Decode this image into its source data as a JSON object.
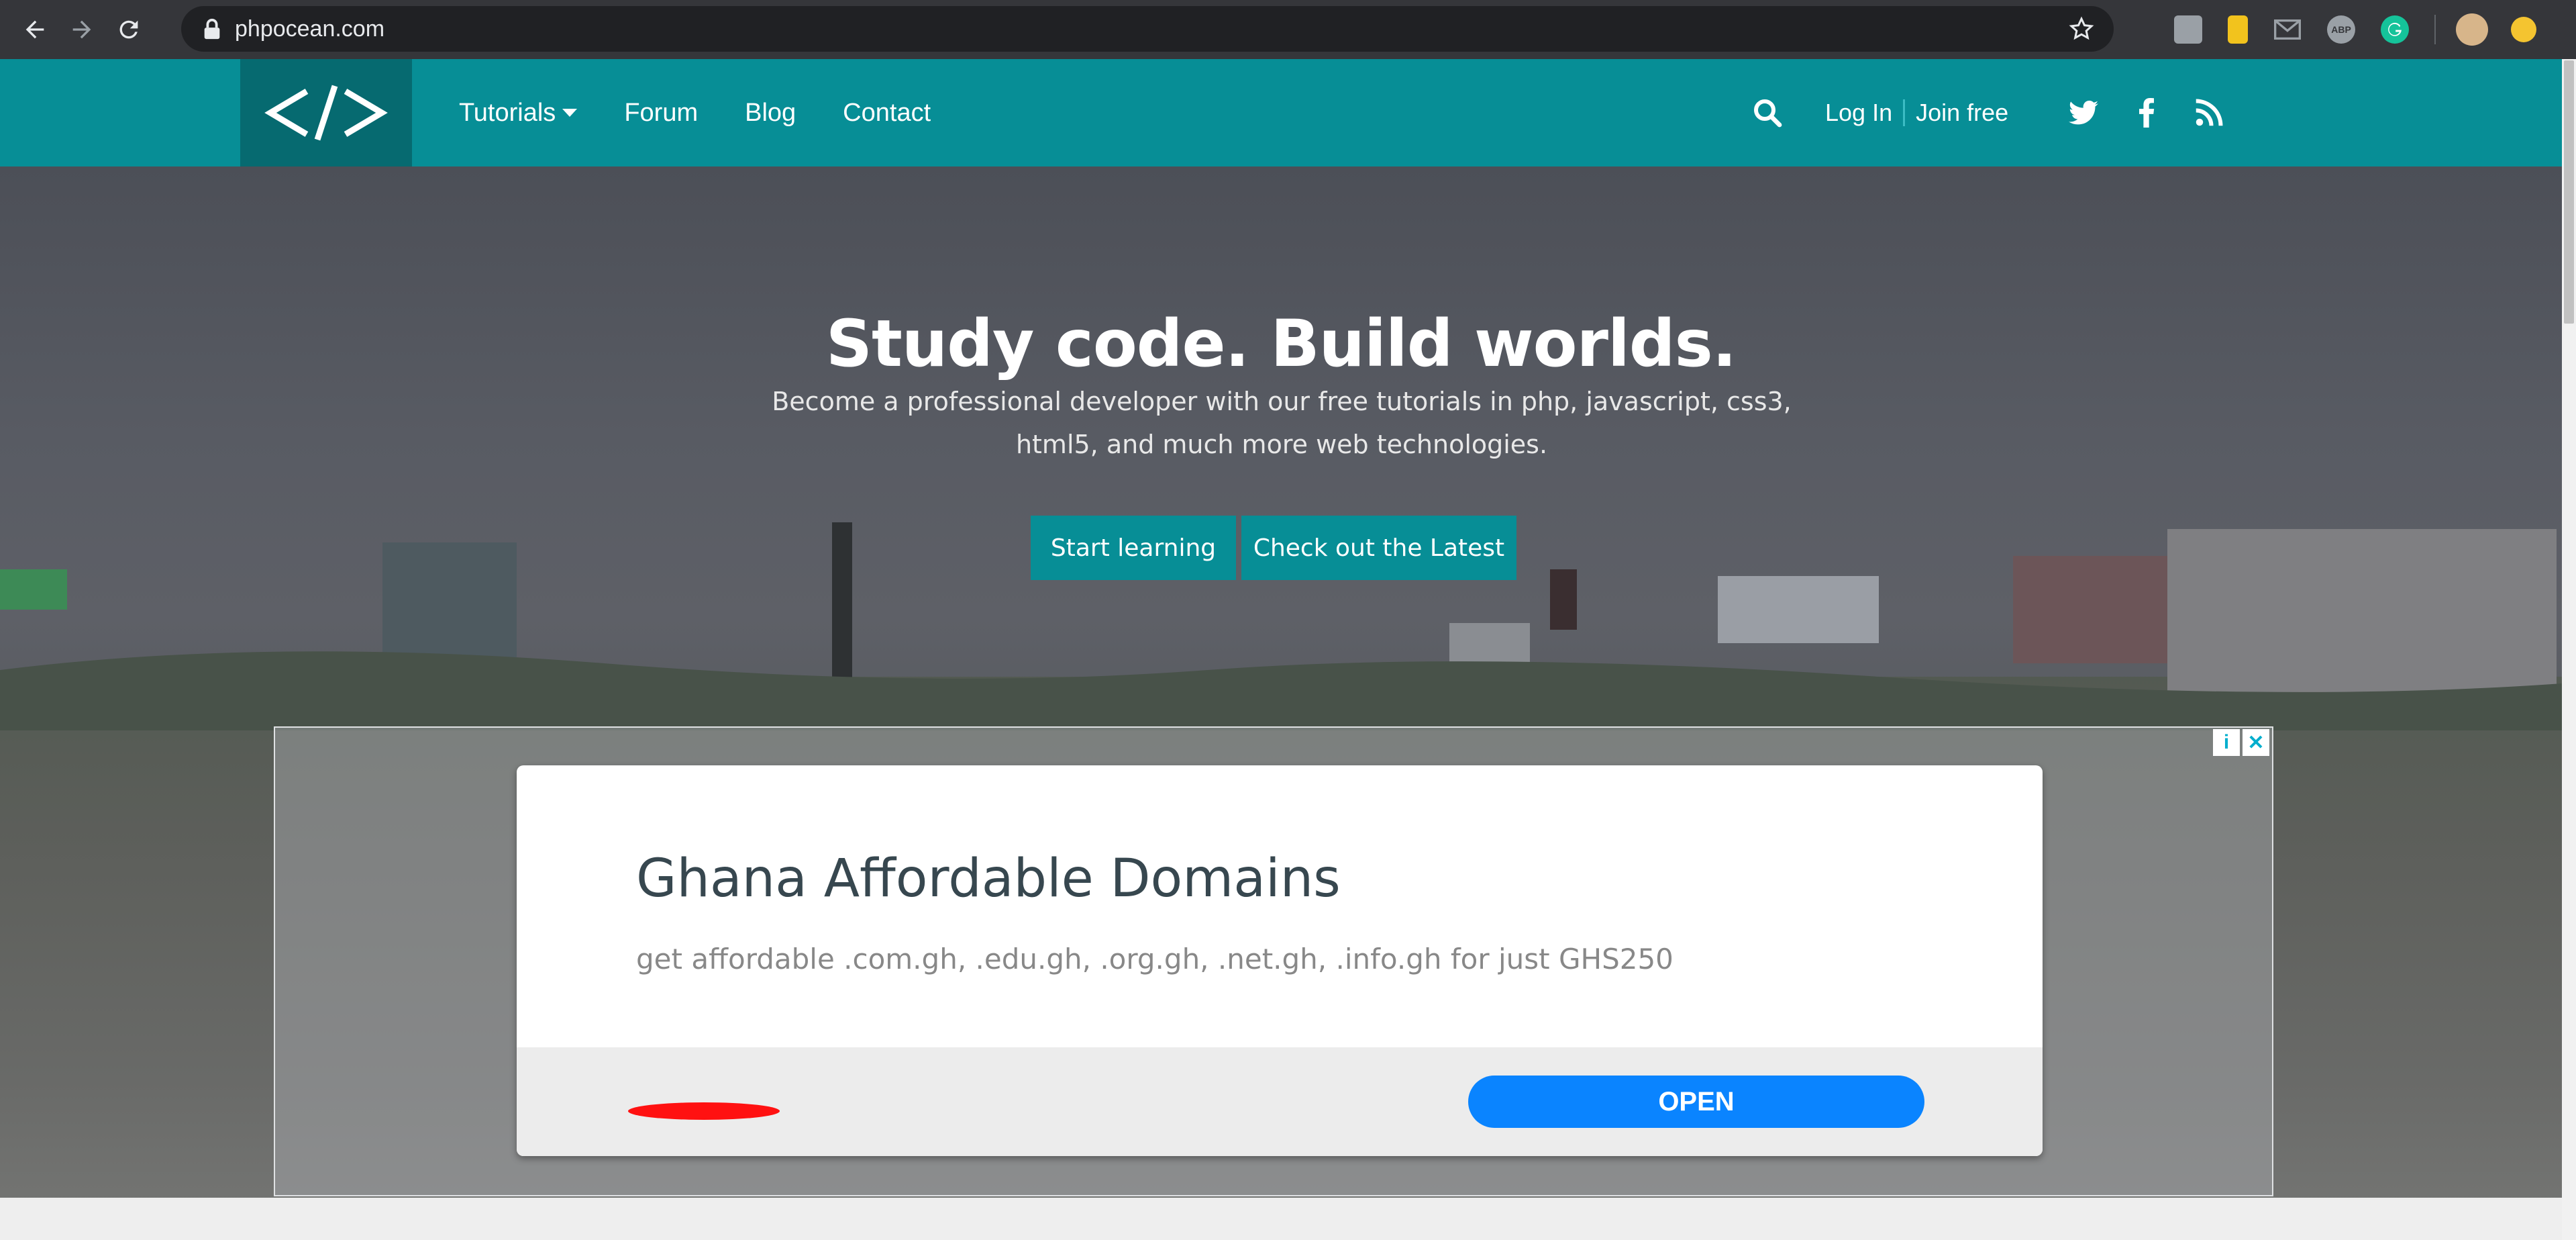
{
  "browser": {
    "url": "phpocean.com",
    "icons": [
      "back-icon",
      "forward-icon",
      "reload-icon",
      "lock-icon",
      "star-icon"
    ],
    "extensions": [
      "ext-grey-icon",
      "ext-yellow-icon",
      "mail-icon",
      "adblock-icon",
      "grammarly-icon",
      "avatar",
      "update-icon"
    ],
    "adblock_label": "ABP"
  },
  "header": {
    "nav": {
      "tutorials": "Tutorials",
      "forum": "Forum",
      "blog": "Blog",
      "contact": "Contact"
    },
    "auth": {
      "login": "Log In",
      "join": "Join free"
    },
    "social": [
      "twitter-icon",
      "facebook-icon",
      "rss-icon"
    ]
  },
  "hero": {
    "title": "Study code. Build worlds.",
    "subtitle": "Become a professional developer with our free tutorials in php, javascript, css3, html5, and much more web technologies.",
    "btn_start": "Start learning",
    "btn_latest": "Check out the Latest"
  },
  "ad": {
    "title": "Ghana Affordable Domains",
    "description": "get affordable .com.gh, .edu.gh, .org.gh, .net.gh, .info.gh for just GHS250",
    "open_label": "OPEN",
    "info_label": "i",
    "close_label": "✕"
  },
  "colors": {
    "brand": "#078e96",
    "brand_dark": "#066a70",
    "ad_button": "#0a84ff"
  }
}
